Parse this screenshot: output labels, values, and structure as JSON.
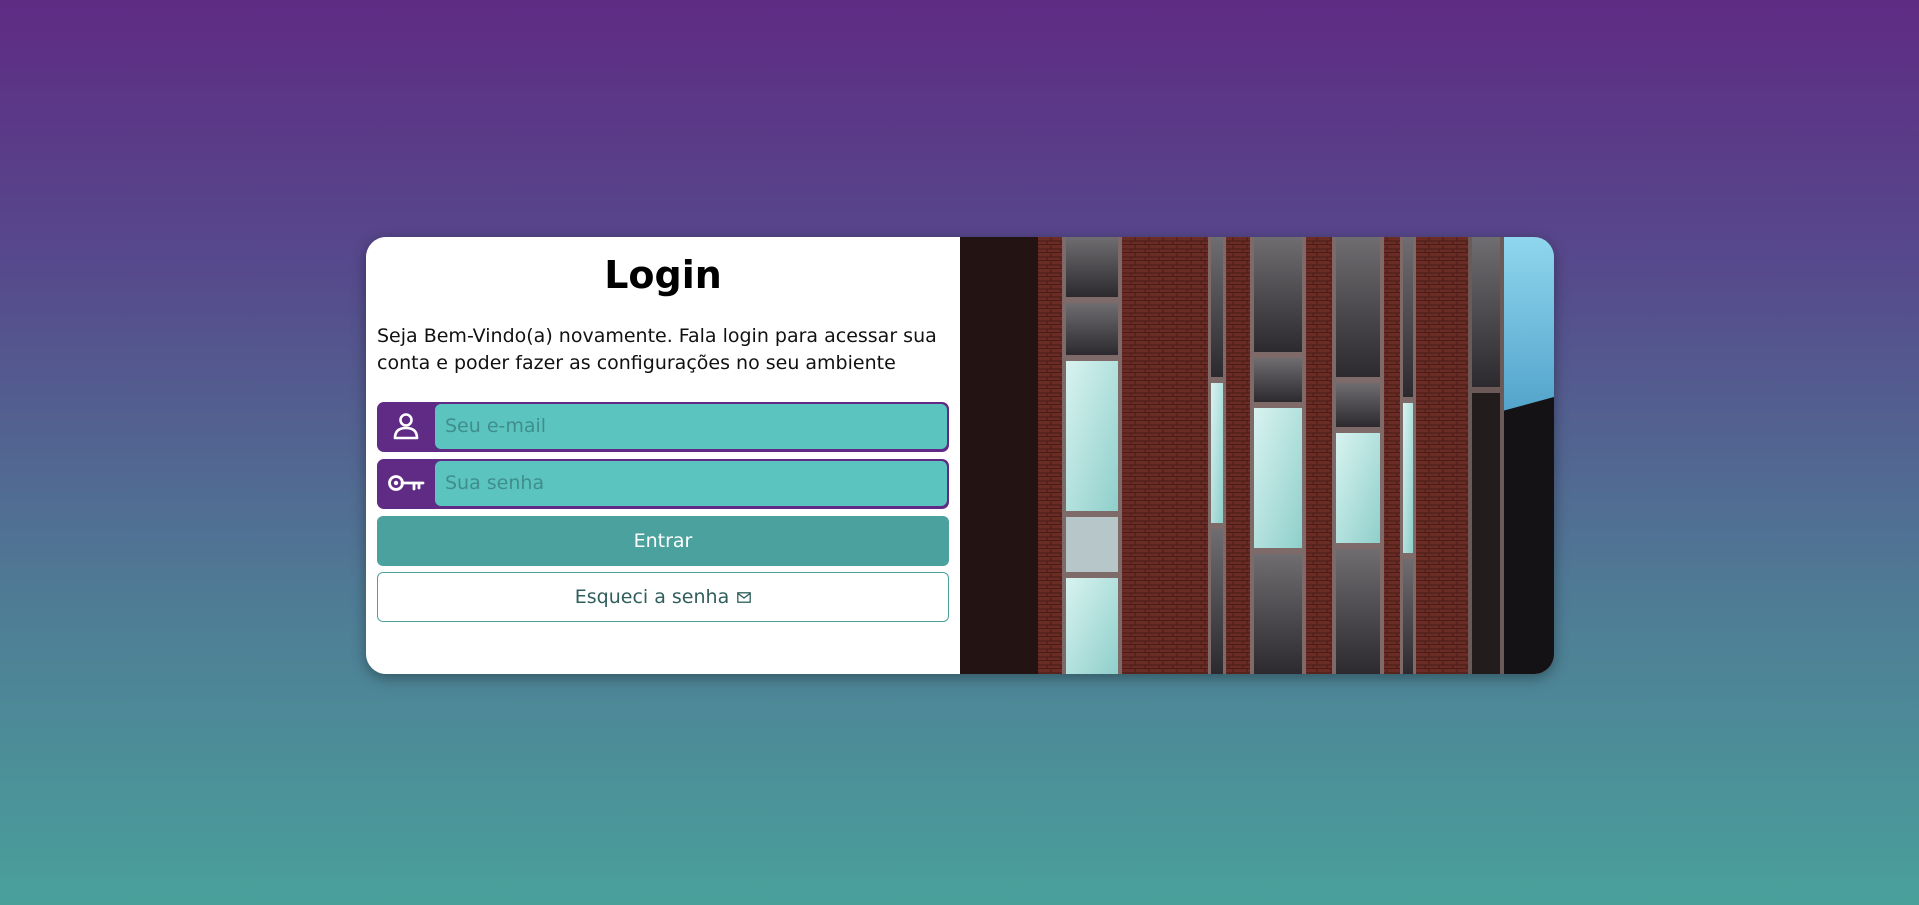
{
  "login": {
    "title": "Login",
    "intro": "Seja Bem-Vindo(a) novamente. Fala login para acessar sua conta e poder fazer as configurações no seu ambiente",
    "email": {
      "placeholder": "Seu e-mail",
      "value": "",
      "icon": "user-icon"
    },
    "password": {
      "placeholder": "Sua senha",
      "value": "",
      "icon": "key-icon"
    },
    "submit_label": "Entrar",
    "forgot_label": "Esqueci a senha",
    "forgot_icon": "envelope-icon"
  },
  "hero": {
    "icon": "building-photo"
  },
  "colors": {
    "primary": "#5f2b84",
    "accent": "#4aa19d",
    "input_bg": "#5bc4bf"
  }
}
